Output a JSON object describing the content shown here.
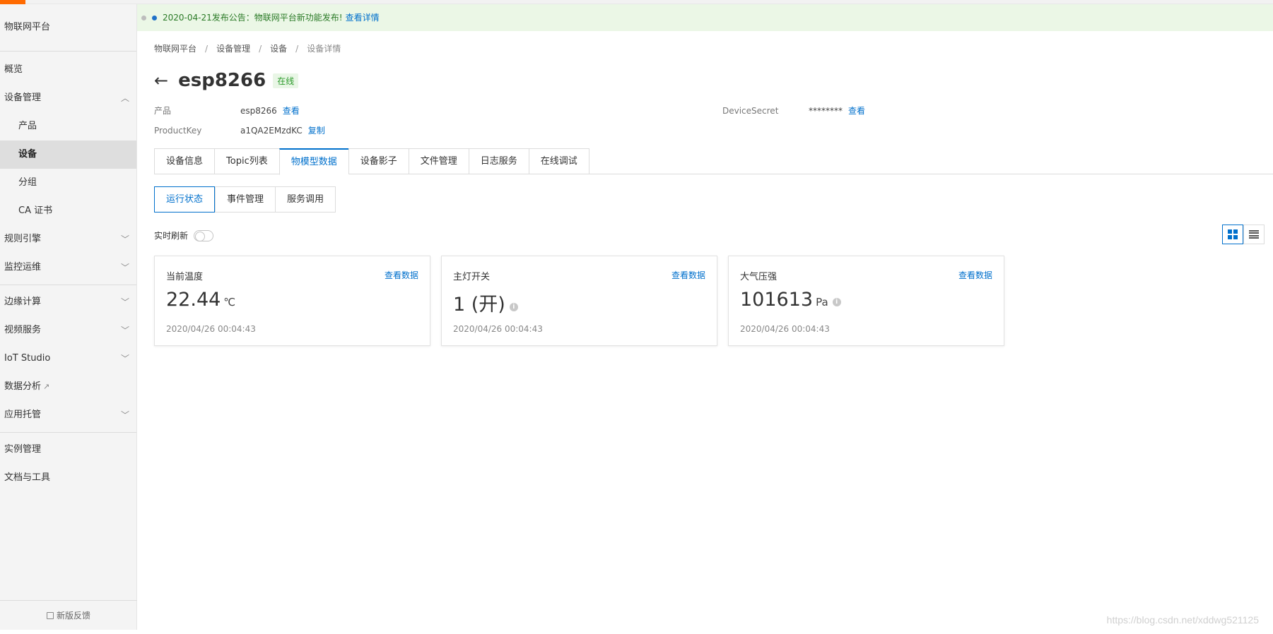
{
  "notice": {
    "text": "2020-04-21发布公告：物联网平台新功能发布!",
    "link": "查看详情"
  },
  "sidebar": {
    "title": "物联网平台",
    "items": [
      {
        "label": "概览"
      },
      {
        "label": "设备管理"
      },
      {
        "label": "产品"
      },
      {
        "label": "设备"
      },
      {
        "label": "分组"
      },
      {
        "label": "CA 证书"
      },
      {
        "label": "规则引擎"
      },
      {
        "label": "监控运维"
      },
      {
        "label": "边缘计算"
      },
      {
        "label": "视频服务"
      },
      {
        "label": "IoT Studio"
      },
      {
        "label": "数据分析"
      },
      {
        "label": "应用托管"
      },
      {
        "label": "实例管理"
      },
      {
        "label": "文档与工具"
      }
    ],
    "feedback": "新版反馈"
  },
  "breadcrumb": [
    "物联网平台",
    "设备管理",
    "设备",
    "设备详情"
  ],
  "device": {
    "name": "esp8266",
    "status": "在线",
    "product_label": "产品",
    "product_value": "esp8266",
    "product_link": "查看",
    "productkey_label": "ProductKey",
    "productkey_value": "a1QA2EMzdKC",
    "productkey_link": "复制",
    "secret_label": "DeviceSecret",
    "secret_value": "********",
    "secret_link": "查看"
  },
  "tabs": [
    "设备信息",
    "Topic列表",
    "物模型数据",
    "设备影子",
    "文件管理",
    "日志服务",
    "在线调试"
  ],
  "subtabs": [
    "运行状态",
    "事件管理",
    "服务调用"
  ],
  "refresh_label": "实时刷新",
  "cards": [
    {
      "title": "当前温度",
      "link": "查看数据",
      "value": "22.44",
      "unit": "℃",
      "time": "2020/04/26 00:04:43"
    },
    {
      "title": "主灯开关",
      "link": "查看数据",
      "value": "1 (开)",
      "unit": "",
      "time": "2020/04/26 00:04:43"
    },
    {
      "title": "大气压强",
      "link": "查看数据",
      "value": "101613",
      "unit": "Pa",
      "time": "2020/04/26 00:04:43"
    }
  ],
  "watermark": "https://blog.csdn.net/xddwg521125",
  "colors": {
    "accent": "#0070cc",
    "brand": "#ff6a00",
    "online": "#2a9a2a"
  }
}
